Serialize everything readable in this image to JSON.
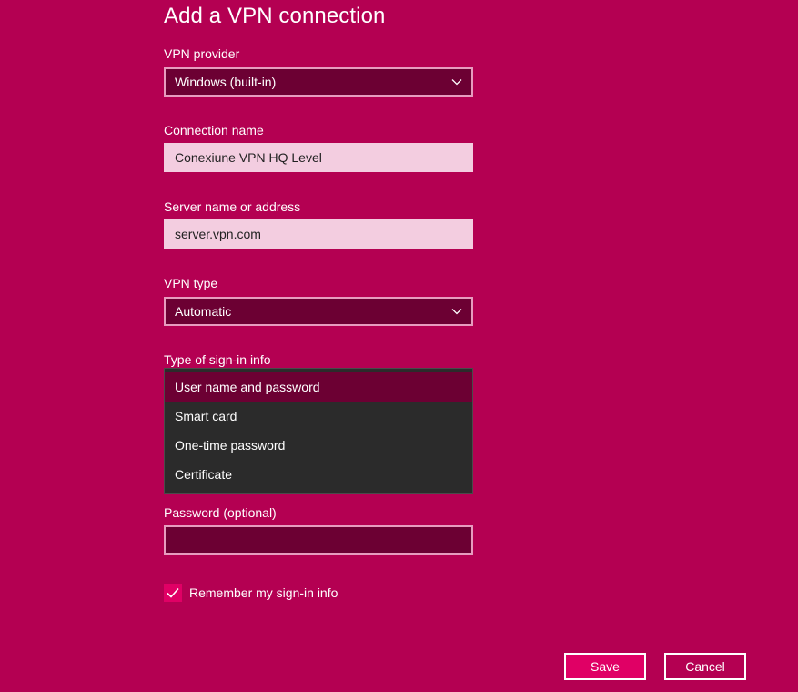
{
  "dialog": {
    "title": "Add a VPN connection"
  },
  "vpn_provider": {
    "label": "VPN provider",
    "value": "Windows (built-in)"
  },
  "connection_name": {
    "label": "Connection name",
    "value": "Conexiune VPN HQ Level"
  },
  "server": {
    "label": "Server name or address",
    "value": "server.vpn.com"
  },
  "vpn_type": {
    "label": "VPN type",
    "value": "Automatic"
  },
  "sign_in": {
    "label": "Type of sign-in info",
    "options": [
      "User name and password",
      "Smart card",
      "One-time password",
      "Certificate"
    ],
    "selected": "User name and password"
  },
  "password": {
    "label": "Password (optional)",
    "value": ""
  },
  "remember": {
    "label": "Remember my sign-in info",
    "checked": true
  },
  "buttons": {
    "save": "Save",
    "cancel": "Cancel"
  },
  "colors": {
    "background": "#b40052",
    "field_dark": "#6c0033",
    "field_light": "#f3cde0",
    "accent": "#e00065",
    "dropdown_bg": "#2b2b2b"
  },
  "icons": {
    "dropdown": "chevron-down-icon",
    "checkbox": "checkmark-icon"
  }
}
